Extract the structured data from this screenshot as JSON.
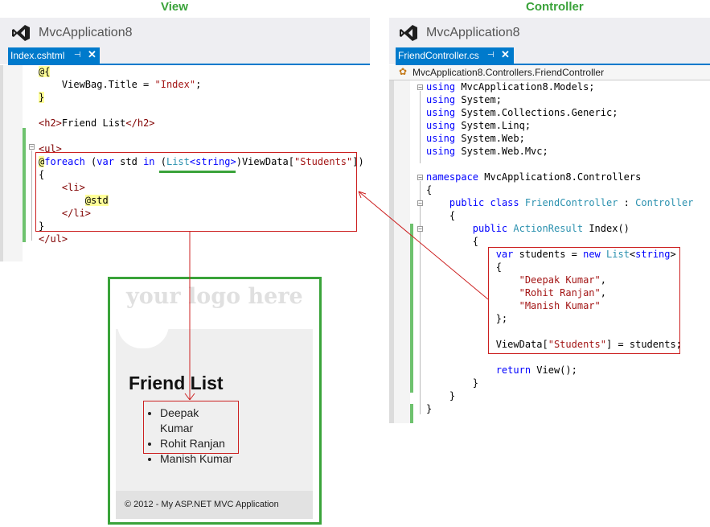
{
  "headings": {
    "view": "View",
    "controller": "Controller"
  },
  "view_panel": {
    "app_title": "MvcApplication8",
    "tab_label": "Index.cshtml",
    "code": {
      "l1": "@{",
      "l2_pre": "ViewBag.Title = ",
      "l2_str": "\"Index\"",
      "l2_post": ";",
      "l3": "}",
      "l5_tag_open": "<h2>",
      "l5_text": "Friend List",
      "l5_tag_close": "</h2>",
      "l7": "<ul>",
      "l8_at": "@",
      "l8_foreach": "foreach",
      "l8_paren": " (",
      "l8_var": "var",
      "l8_std": " std ",
      "l8_in": "in",
      "l8_sp": " (",
      "l8_list": "List",
      "l8_lt": "<",
      "l8_string": "string",
      "l8_gt": ">",
      "l8_close": ")",
      "l8_viewdata": "ViewData",
      "l8_ob": "[",
      "l8_key": "\"Students\"",
      "l8_end": "])",
      "l9": "{",
      "l10": "<li>",
      "l11": "@std",
      "l12": "</li>",
      "l13": "}",
      "l14": "</ul>"
    }
  },
  "controller_panel": {
    "app_title": "MvcApplication8",
    "tab_label": "FriendController.cs",
    "breadcrumb": "MvcApplication8.Controllers.FriendController",
    "code": {
      "using": "using",
      "u1": " MvcApplication8.Models;",
      "u2": " System;",
      "u3": " System.Collections.Generic;",
      "u4": " System.Linq;",
      "u5": " System.Web;",
      "u6": " System.Web.Mvc;",
      "namespace_kw": "namespace",
      "namespace_name": " MvcApplication8.Controllers",
      "brace_open": "{",
      "brace_close": "}",
      "public_kw": "public",
      "class_kw": "class",
      "class_name": "FriendController",
      "colon": " : ",
      "base_class": "Controller",
      "return_type": "ActionResult",
      "method": " Index()",
      "var_kw": "var",
      "students": " students = ",
      "new_kw": "new",
      "list_type": "List",
      "lt": "<",
      "string_kw": "string",
      "gt": ">",
      "s1": "\"Deepak Kumar\"",
      "s2": "\"Rohit Ranjan\"",
      "s3": "\"Manish Kumar\"",
      "comma": ",",
      "close_init": "};",
      "viewdata_line_pre": "ViewData[",
      "viewdata_key": "\"Students\"",
      "viewdata_line_post": "] = students;",
      "return_kw": "return",
      "return_rest": " View();"
    }
  },
  "browser": {
    "logo": "your logo here",
    "page_title": "Friend List",
    "items": [
      "Deepak Kumar",
      "Rohit Ranjan",
      "Manish Kumar"
    ],
    "footer": "© 2012 - My ASP.NET MVC Application"
  },
  "colors": {
    "accent_blue": "#007acc",
    "highlight_green": "#3aa33a",
    "annotation_red": "#cc2020"
  }
}
